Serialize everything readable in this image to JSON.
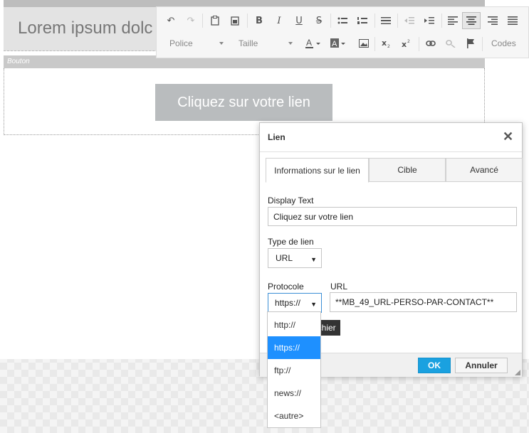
{
  "editor": {
    "lorem_text": "Lorem ipsum dolc",
    "bouton_label": "Bouton",
    "cta_text": "Cliquez sur votre lien"
  },
  "toolbar": {
    "font_combo": "Police",
    "size_combo": "Taille",
    "codes_label": "Codes",
    "bold": "B",
    "italic": "I",
    "underline": "U",
    "strike": "S"
  },
  "dialog": {
    "title": "Lien",
    "close_glyph": "✕",
    "tabs": [
      "Informations sur le lien",
      "Cible",
      "Avancé"
    ],
    "display_text_label": "Display Text",
    "display_text_value": "Cliquez sur votre lien",
    "link_type_label": "Type de lien",
    "link_type_value": "URL",
    "protocol_label": "Protocole",
    "protocol_value": "https://",
    "url_label": "URL",
    "url_value": "**MB_49_URL-PERSO-PAR-CONTACT**",
    "ok": "OK",
    "cancel": "Annuler",
    "tooltip_partial": "ichier",
    "arrow_glyph": "▼"
  },
  "protocol_options": [
    "http://",
    "https://",
    "ftp://",
    "news://",
    "<autre>"
  ],
  "colors": {
    "accent": "#1aa1e0",
    "selected_option": "#1e90ff",
    "button_gray": "#b9bcbe"
  }
}
